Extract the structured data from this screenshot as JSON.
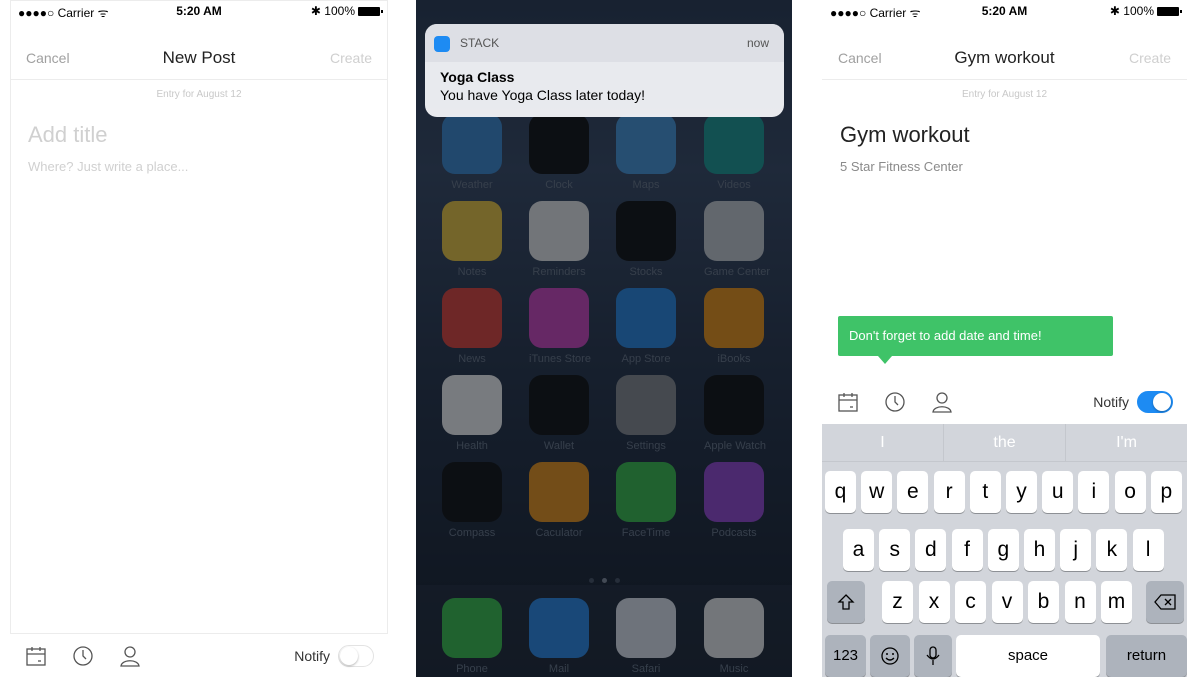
{
  "new_post_screen": {
    "status": {
      "carrier": "●●●●○ Carrier ᯤ",
      "time": "5:20 AM",
      "battery": "✱ 100%"
    },
    "nav": {
      "cancel": "Cancel",
      "title": "New Post",
      "create": "Create"
    },
    "entry_label": "Entry for August 12",
    "title_placeholder": "Add title",
    "place_placeholder": "Where? Just write a place...",
    "toolbar": {
      "notify_label": "Notify",
      "notify_on": false,
      "icons": [
        "calendar-icon",
        "clock-icon",
        "person-icon"
      ]
    }
  },
  "home_screen": {
    "notification": {
      "app_name": "STACK",
      "time": "now",
      "title": "Yoga Class",
      "body": "You have Yoga Class later today!"
    },
    "apps": [
      {
        "label": "Weather",
        "color": "#3f8fd8"
      },
      {
        "label": "Clock",
        "color": "#111111"
      },
      {
        "label": "Maps",
        "color": "#4b9be0"
      },
      {
        "label": "Videos",
        "color": "#1d9f9a"
      },
      {
        "label": "Notes",
        "color": "#f6cf43"
      },
      {
        "label": "Reminders",
        "color": "#f2f2f2"
      },
      {
        "label": "Stocks",
        "color": "#111111"
      },
      {
        "label": "Game Center",
        "color": "#cfd3d8"
      },
      {
        "label": "News",
        "color": "#e9453d"
      },
      {
        "label": "iTunes Store",
        "color": "#d748c6"
      },
      {
        "label": "App Store",
        "color": "#2b8de8"
      },
      {
        "label": "iBooks",
        "color": "#f79a17"
      },
      {
        "label": "Health",
        "color": "#ffffff"
      },
      {
        "label": "Wallet",
        "color": "#111111"
      },
      {
        "label": "Settings",
        "color": "#8e9096"
      },
      {
        "label": "Apple Watch",
        "color": "#111111"
      },
      {
        "label": "Compass",
        "color": "#111111"
      },
      {
        "label": "Caculator",
        "color": "#f39a1b"
      },
      {
        "label": "FaceTime",
        "color": "#3dc64f"
      },
      {
        "label": "Podcasts",
        "color": "#9b4ad9"
      }
    ],
    "dock": [
      {
        "label": "Phone",
        "color": "#3cc84f"
      },
      {
        "label": "Mail",
        "color": "#2d8ff0"
      },
      {
        "label": "Safari",
        "color": "#e9eef5"
      },
      {
        "label": "Music",
        "color": "#f4f4f4"
      }
    ]
  },
  "gym_screen": {
    "status": {
      "carrier": "●●●●○ Carrier ᯤ",
      "time": "5:20 AM",
      "battery": "✱ 100%"
    },
    "nav": {
      "cancel": "Cancel",
      "title": "Gym workout",
      "create": "Create"
    },
    "entry_label": "Entry for August 12",
    "title_value": "Gym workout",
    "place_value": "5 Star Fitness Center",
    "tooltip": "Don't forget to add date and time!",
    "toolbar": {
      "notify_label": "Notify",
      "notify_on": true
    },
    "keyboard": {
      "suggestions": [
        "I",
        "the",
        "I'm"
      ],
      "row1": [
        "q",
        "w",
        "e",
        "r",
        "t",
        "y",
        "u",
        "i",
        "o",
        "p"
      ],
      "row2": [
        "a",
        "s",
        "d",
        "f",
        "g",
        "h",
        "j",
        "k",
        "l"
      ],
      "row3": [
        "z",
        "x",
        "c",
        "v",
        "b",
        "n",
        "m"
      ],
      "numbers_key": "123",
      "space_key": "space",
      "return_key": "return"
    }
  },
  "colors": {
    "accent_blue": "#1d8bf3",
    "tooltip_green": "#3fc368"
  }
}
